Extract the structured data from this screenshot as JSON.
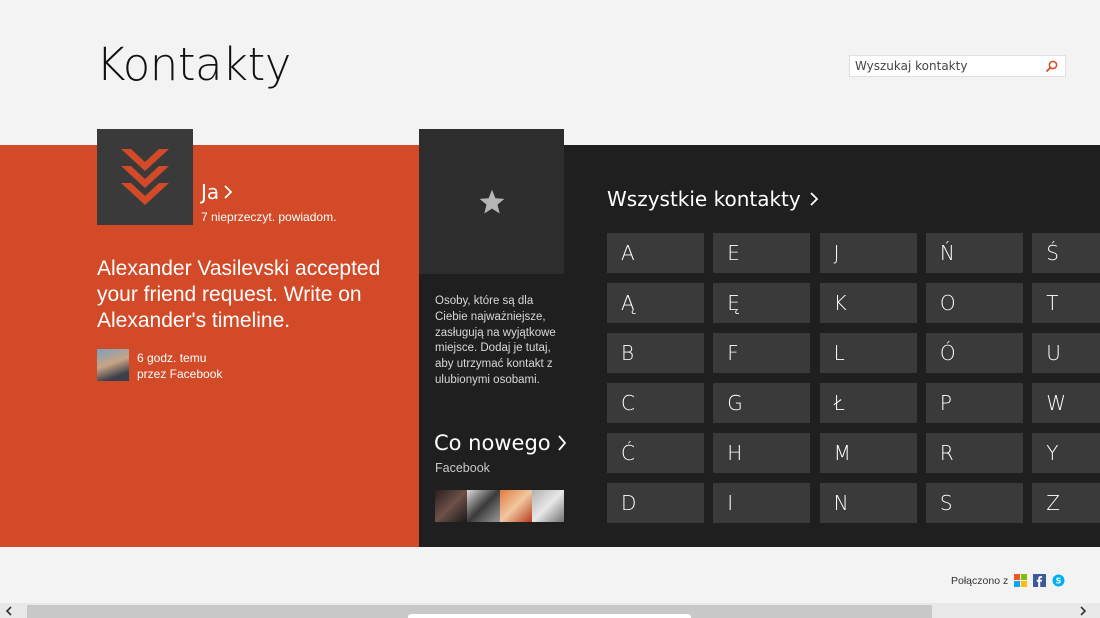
{
  "header": {
    "title": "Kontakty",
    "search_placeholder": "Wyszukaj kontakty"
  },
  "me": {
    "label": "Ja",
    "notifications": "7 nieprzeczyt. powiadom.",
    "activity_text": "Alexander Vasilevski accepted your friend request. Write on Alexander's timeline.",
    "activity_time": "6 godz. temu",
    "activity_source": "przez Facebook"
  },
  "favorites": {
    "description": "Osoby, które są dla Ciebie najważniejsze, zasługują na wyjątkowe miejsce. Dodaj je tutaj, aby utrzymać kontakt z ulubionymi osobami."
  },
  "whats_new": {
    "title": "Co nowego",
    "source": "Facebook"
  },
  "all_contacts": {
    "title": "Wszystkie kontakty",
    "letters": [
      [
        "A",
        "Ą",
        "B",
        "C",
        "Ć",
        "D"
      ],
      [
        "E",
        "Ę",
        "F",
        "G",
        "H",
        "I"
      ],
      [
        "J",
        "K",
        "L",
        "Ł",
        "M",
        "N"
      ],
      [
        "Ń",
        "O",
        "Ó",
        "P",
        "R",
        "S"
      ],
      [
        "Ś",
        "T",
        "U",
        "W",
        "Y",
        "Z"
      ]
    ]
  },
  "footer": {
    "connected_label": "Połączono z"
  },
  "colors": {
    "accent_orange": "#d24a28",
    "dark_panel": "#1f1f1f",
    "tile": "#3a3a3a"
  }
}
